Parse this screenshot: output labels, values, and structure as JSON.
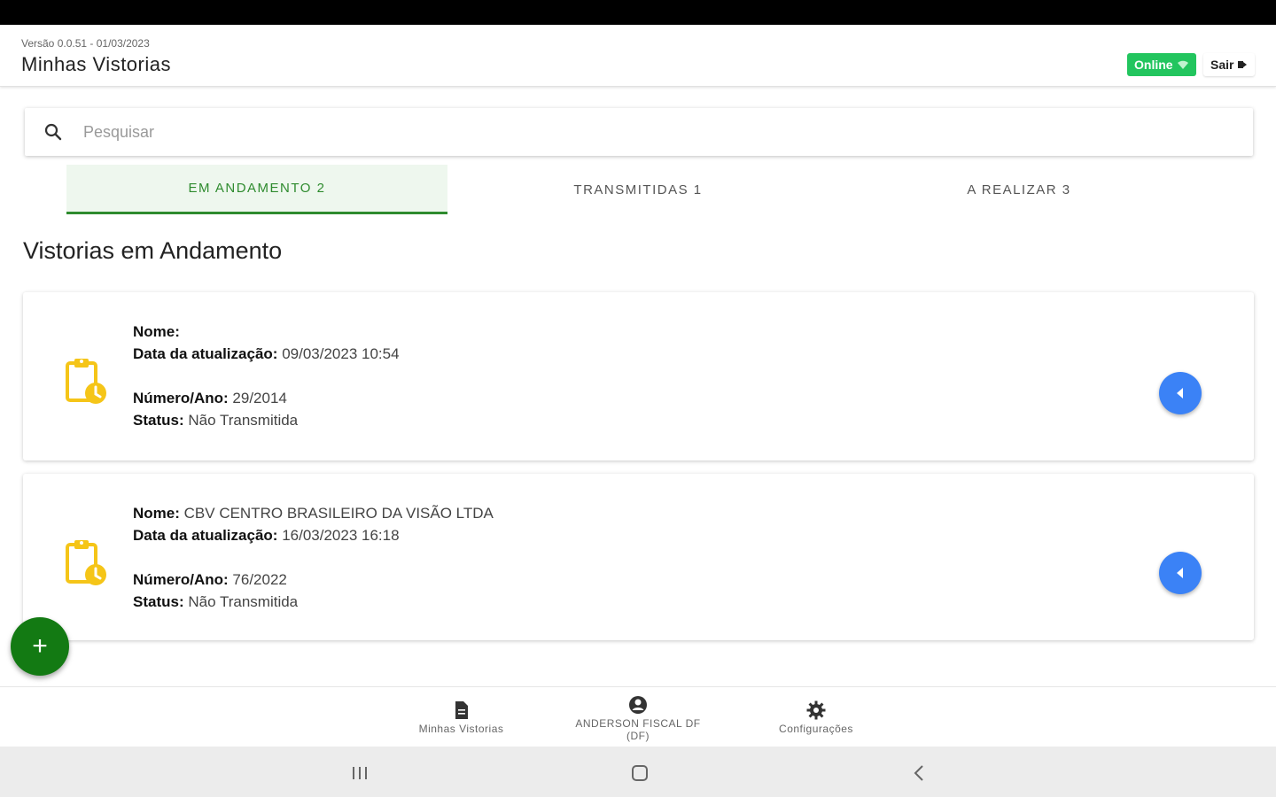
{
  "header": {
    "version": "Versão 0.0.51 - 01/03/2023",
    "title": "Minhas Vistorias",
    "online_label": "Online",
    "logout_label": "Sair"
  },
  "search": {
    "placeholder": "Pesquisar"
  },
  "tabs": [
    {
      "label": "EM ANDAMENTO 2",
      "active": true
    },
    {
      "label": "TRANSMITIDAS 1",
      "active": false
    },
    {
      "label": "A REALIZAR 3",
      "active": false
    }
  ],
  "section_title": "Vistorias em Andamento",
  "labels": {
    "nome": "Nome:",
    "data": "Data da atualização:",
    "numero": "Número/Ano:",
    "status": "Status:"
  },
  "cards": [
    {
      "nome": "",
      "data": "09/03/2023 10:54",
      "numero": "29/2014",
      "status": "Não Transmitida"
    },
    {
      "nome": "CBV CENTRO BRASILEIRO DA VISÃO LTDA",
      "data": "16/03/2023 16:18",
      "numero": "76/2022",
      "status": "Não Transmitida"
    }
  ],
  "fab_label": "+",
  "bottom_nav": [
    {
      "label": "Minhas Vistorias",
      "icon": "document-icon"
    },
    {
      "label": "ANDERSON FISCAL DF (DF)",
      "icon": "user-circle-icon"
    },
    {
      "label": "Configurações",
      "icon": "gear-icon"
    }
  ],
  "colors": {
    "accent_green": "#2e8b2e",
    "online_green": "#22c55e",
    "fab_green": "#137a13",
    "action_blue": "#3b82f6",
    "icon_yellow": "#f5c518"
  }
}
